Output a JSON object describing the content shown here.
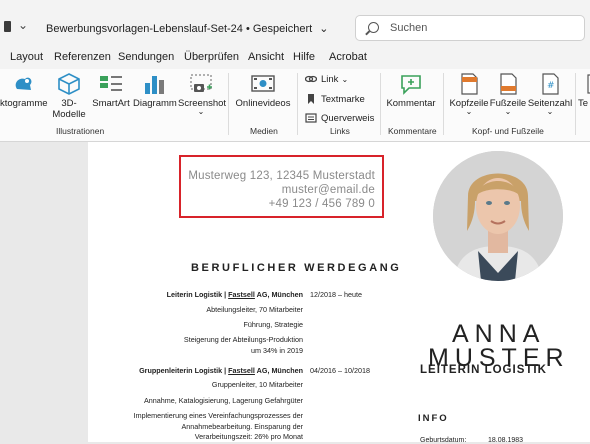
{
  "title_bar": {
    "quick_access_chevron": "⌄",
    "document_title": "Bewerbungsvorlagen-Lebenslauf-Set-24 • Gespeichert",
    "saved_chevron": "⌄",
    "search_placeholder": "Suchen"
  },
  "menu_tabs": [
    "Layout",
    "Referenzen",
    "Sendungen",
    "Überprüfen",
    "Ansicht",
    "Hilfe",
    "Acrobat"
  ],
  "ribbon": {
    "illustrationen": {
      "piktogramme": "ktogramme",
      "modelle_line1": "3D-",
      "modelle_line2": "Modelle",
      "smartart": "SmartArt",
      "diagramm": "Diagramm",
      "screenshot": "Screenshot",
      "dropdown": "⌄",
      "group_label": "Illustrationen"
    },
    "medien": {
      "onlinevideos": "Onlinevideos",
      "group_label": "Medien"
    },
    "links": {
      "link": "Link",
      "textmarke": "Textmarke",
      "querverweis": "Querverweis",
      "group_label": "Links"
    },
    "kommentare": {
      "kommentar": "Kommentar",
      "group_label": "Kommentare"
    },
    "kopf_fusszeile": {
      "kopfzeile": "Kopfzeile",
      "fusszeile": "Fußzeile",
      "seitenzahl": "Seitenzahl",
      "group_label": "Kopf- und Fußzeile"
    },
    "text_partial": "Te"
  },
  "document": {
    "address": "Musterweg 123, 12345 Musterstadt",
    "email": "muster@email.de",
    "phone": "+49 123 / 456 789 0",
    "section_title": "BERUFLICHER WERDEGANG",
    "job1": {
      "title": "Leiterin Logistik",
      "separator": " | ",
      "company": "Fastsell",
      "location": " AG, München",
      "date": "12/2018 – heute",
      "lines": [
        "Abteilungsleiter, 70 Mitarbeiter",
        "Führung, Strategie",
        "Steigerung der Abteilungs-Produktion",
        "um 34% in 2019"
      ]
    },
    "job2": {
      "title": "Gruppenleiterin Logistik",
      "separator": " | ",
      "company": "Fastsell",
      "location": " AG, München",
      "date": "04/2016 – 10/2018",
      "lines": [
        "Gruppenleiter, 10 Mitarbeiter",
        "Annahme, Katalogisierung, Lagerung Gefahrgüter",
        "Implementierung eines Vereinfachungsprozesses der",
        "Annahmebearbeitung. Einsparung der",
        "Verarbeitungszeit: 26% pro Monat"
      ]
    },
    "first_name": "ANNA",
    "last_name": "MUSTER",
    "role": "LEITERIN LOGISTIK",
    "info_title": "INFO",
    "info_label": "Geburtsdatum:",
    "info_value": "18.08.1983"
  },
  "colors": {
    "highlight_border": "#d8232a",
    "address_text": "#8a8a8a"
  }
}
